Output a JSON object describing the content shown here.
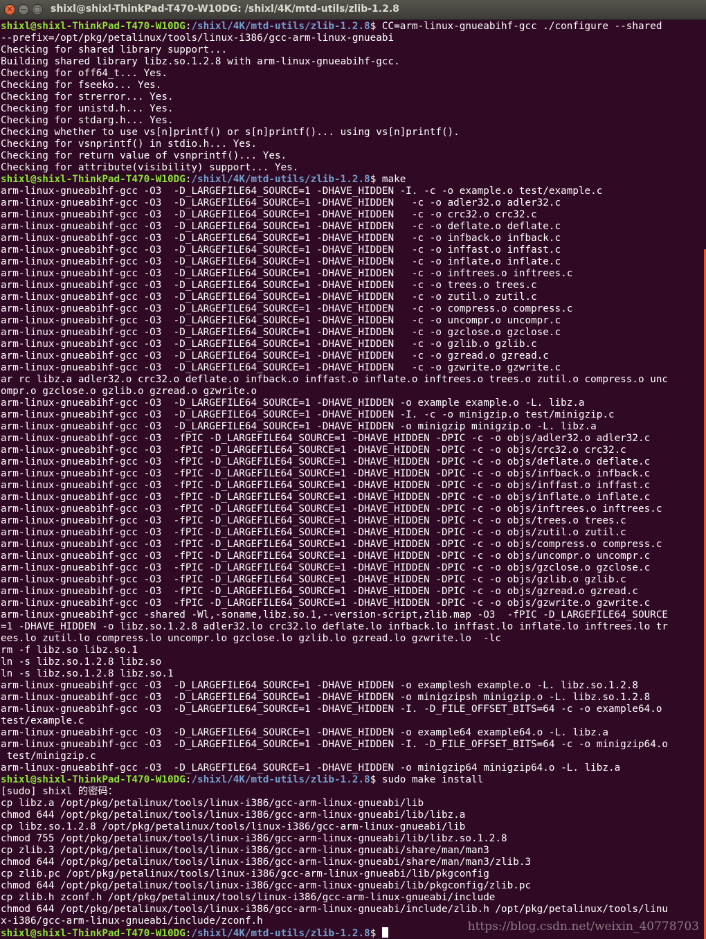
{
  "window": {
    "title": "shixl@shixl-ThinkPad-T470-W10DG: /shixl/4K/mtd-utils/zlib-1.2.8",
    "close_glyph": "✕",
    "minimize_glyph": "−",
    "maximize_glyph": "□"
  },
  "prompt": {
    "user_host": "shixl@shixl-ThinkPad-T470-W10DG",
    "separator": ":",
    "path": "/shixl/4K/mtd-utils/zlib-1.2.8",
    "symbol": "$ "
  },
  "lines": [
    {
      "type": "prompt",
      "cmd": "CC=arm-linux-gnueabihf-gcc ./configure --shared"
    },
    {
      "type": "out",
      "text": "--prefix=/opt/pkg/petalinux/tools/linux-i386/gcc-arm-linux-gnueabi"
    },
    {
      "type": "out",
      "text": "Checking for shared library support..."
    },
    {
      "type": "out",
      "text": "Building shared library libz.so.1.2.8 with arm-linux-gnueabihf-gcc."
    },
    {
      "type": "out",
      "text": "Checking for off64_t... Yes."
    },
    {
      "type": "out",
      "text": "Checking for fseeko... Yes."
    },
    {
      "type": "out",
      "text": "Checking for strerror... Yes."
    },
    {
      "type": "out",
      "text": "Checking for unistd.h... Yes."
    },
    {
      "type": "out",
      "text": "Checking for stdarg.h... Yes."
    },
    {
      "type": "out",
      "text": "Checking whether to use vs[n]printf() or s[n]printf()... using vs[n]printf()."
    },
    {
      "type": "out",
      "text": "Checking for vsnprintf() in stdio.h... Yes."
    },
    {
      "type": "out",
      "text": "Checking for return value of vsnprintf()... Yes."
    },
    {
      "type": "out",
      "text": "Checking for attribute(visibility) support... Yes."
    },
    {
      "type": "prompt",
      "cmd": "make"
    },
    {
      "type": "out",
      "text": "arm-linux-gnueabihf-gcc -O3  -D_LARGEFILE64_SOURCE=1 -DHAVE_HIDDEN -I. -c -o example.o test/example.c"
    },
    {
      "type": "out",
      "text": "arm-linux-gnueabihf-gcc -O3  -D_LARGEFILE64_SOURCE=1 -DHAVE_HIDDEN   -c -o adler32.o adler32.c"
    },
    {
      "type": "out",
      "text": "arm-linux-gnueabihf-gcc -O3  -D_LARGEFILE64_SOURCE=1 -DHAVE_HIDDEN   -c -o crc32.o crc32.c"
    },
    {
      "type": "out",
      "text": "arm-linux-gnueabihf-gcc -O3  -D_LARGEFILE64_SOURCE=1 -DHAVE_HIDDEN   -c -o deflate.o deflate.c"
    },
    {
      "type": "out",
      "text": "arm-linux-gnueabihf-gcc -O3  -D_LARGEFILE64_SOURCE=1 -DHAVE_HIDDEN   -c -o infback.o infback.c"
    },
    {
      "type": "out",
      "text": "arm-linux-gnueabihf-gcc -O3  -D_LARGEFILE64_SOURCE=1 -DHAVE_HIDDEN   -c -o inffast.o inffast.c"
    },
    {
      "type": "out",
      "text": "arm-linux-gnueabihf-gcc -O3  -D_LARGEFILE64_SOURCE=1 -DHAVE_HIDDEN   -c -o inflate.o inflate.c"
    },
    {
      "type": "out",
      "text": "arm-linux-gnueabihf-gcc -O3  -D_LARGEFILE64_SOURCE=1 -DHAVE_HIDDEN   -c -o inftrees.o inftrees.c"
    },
    {
      "type": "out",
      "text": "arm-linux-gnueabihf-gcc -O3  -D_LARGEFILE64_SOURCE=1 -DHAVE_HIDDEN   -c -o trees.o trees.c"
    },
    {
      "type": "out",
      "text": "arm-linux-gnueabihf-gcc -O3  -D_LARGEFILE64_SOURCE=1 -DHAVE_HIDDEN   -c -o zutil.o zutil.c"
    },
    {
      "type": "out",
      "text": "arm-linux-gnueabihf-gcc -O3  -D_LARGEFILE64_SOURCE=1 -DHAVE_HIDDEN   -c -o compress.o compress.c"
    },
    {
      "type": "out",
      "text": "arm-linux-gnueabihf-gcc -O3  -D_LARGEFILE64_SOURCE=1 -DHAVE_HIDDEN   -c -o uncompr.o uncompr.c"
    },
    {
      "type": "out",
      "text": "arm-linux-gnueabihf-gcc -O3  -D_LARGEFILE64_SOURCE=1 -DHAVE_HIDDEN   -c -o gzclose.o gzclose.c"
    },
    {
      "type": "out",
      "text": "arm-linux-gnueabihf-gcc -O3  -D_LARGEFILE64_SOURCE=1 -DHAVE_HIDDEN   -c -o gzlib.o gzlib.c"
    },
    {
      "type": "out",
      "text": "arm-linux-gnueabihf-gcc -O3  -D_LARGEFILE64_SOURCE=1 -DHAVE_HIDDEN   -c -o gzread.o gzread.c"
    },
    {
      "type": "out",
      "text": "arm-linux-gnueabihf-gcc -O3  -D_LARGEFILE64_SOURCE=1 -DHAVE_HIDDEN   -c -o gzwrite.o gzwrite.c"
    },
    {
      "type": "out",
      "text": "ar rc libz.a adler32.o crc32.o deflate.o infback.o inffast.o inflate.o inftrees.o trees.o zutil.o compress.o unc"
    },
    {
      "type": "out",
      "text": "ompr.o gzclose.o gzlib.o gzread.o gzwrite.o"
    },
    {
      "type": "out",
      "text": "arm-linux-gnueabihf-gcc -O3  -D_LARGEFILE64_SOURCE=1 -DHAVE_HIDDEN -o example example.o -L. libz.a"
    },
    {
      "type": "out",
      "text": "arm-linux-gnueabihf-gcc -O3  -D_LARGEFILE64_SOURCE=1 -DHAVE_HIDDEN -I. -c -o minigzip.o test/minigzip.c"
    },
    {
      "type": "out",
      "text": "arm-linux-gnueabihf-gcc -O3  -D_LARGEFILE64_SOURCE=1 -DHAVE_HIDDEN -o minigzip minigzip.o -L. libz.a"
    },
    {
      "type": "out",
      "text": "arm-linux-gnueabihf-gcc -O3  -fPIC -D_LARGEFILE64_SOURCE=1 -DHAVE_HIDDEN -DPIC -c -o objs/adler32.o adler32.c"
    },
    {
      "type": "out",
      "text": "arm-linux-gnueabihf-gcc -O3  -fPIC -D_LARGEFILE64_SOURCE=1 -DHAVE_HIDDEN -DPIC -c -o objs/crc32.o crc32.c"
    },
    {
      "type": "out",
      "text": "arm-linux-gnueabihf-gcc -O3  -fPIC -D_LARGEFILE64_SOURCE=1 -DHAVE_HIDDEN -DPIC -c -o objs/deflate.o deflate.c"
    },
    {
      "type": "out",
      "text": "arm-linux-gnueabihf-gcc -O3  -fPIC -D_LARGEFILE64_SOURCE=1 -DHAVE_HIDDEN -DPIC -c -o objs/infback.o infback.c"
    },
    {
      "type": "out",
      "text": "arm-linux-gnueabihf-gcc -O3  -fPIC -D_LARGEFILE64_SOURCE=1 -DHAVE_HIDDEN -DPIC -c -o objs/inffast.o inffast.c"
    },
    {
      "type": "out",
      "text": "arm-linux-gnueabihf-gcc -O3  -fPIC -D_LARGEFILE64_SOURCE=1 -DHAVE_HIDDEN -DPIC -c -o objs/inflate.o inflate.c"
    },
    {
      "type": "out",
      "text": "arm-linux-gnueabihf-gcc -O3  -fPIC -D_LARGEFILE64_SOURCE=1 -DHAVE_HIDDEN -DPIC -c -o objs/inftrees.o inftrees.c"
    },
    {
      "type": "out",
      "text": "arm-linux-gnueabihf-gcc -O3  -fPIC -D_LARGEFILE64_SOURCE=1 -DHAVE_HIDDEN -DPIC -c -o objs/trees.o trees.c"
    },
    {
      "type": "out",
      "text": "arm-linux-gnueabihf-gcc -O3  -fPIC -D_LARGEFILE64_SOURCE=1 -DHAVE_HIDDEN -DPIC -c -o objs/zutil.o zutil.c"
    },
    {
      "type": "out",
      "text": "arm-linux-gnueabihf-gcc -O3  -fPIC -D_LARGEFILE64_SOURCE=1 -DHAVE_HIDDEN -DPIC -c -o objs/compress.o compress.c"
    },
    {
      "type": "out",
      "text": "arm-linux-gnueabihf-gcc -O3  -fPIC -D_LARGEFILE64_SOURCE=1 -DHAVE_HIDDEN -DPIC -c -o objs/uncompr.o uncompr.c"
    },
    {
      "type": "out",
      "text": "arm-linux-gnueabihf-gcc -O3  -fPIC -D_LARGEFILE64_SOURCE=1 -DHAVE_HIDDEN -DPIC -c -o objs/gzclose.o gzclose.c"
    },
    {
      "type": "out",
      "text": "arm-linux-gnueabihf-gcc -O3  -fPIC -D_LARGEFILE64_SOURCE=1 -DHAVE_HIDDEN -DPIC -c -o objs/gzlib.o gzlib.c"
    },
    {
      "type": "out",
      "text": "arm-linux-gnueabihf-gcc -O3  -fPIC -D_LARGEFILE64_SOURCE=1 -DHAVE_HIDDEN -DPIC -c -o objs/gzread.o gzread.c"
    },
    {
      "type": "out",
      "text": "arm-linux-gnueabihf-gcc -O3  -fPIC -D_LARGEFILE64_SOURCE=1 -DHAVE_HIDDEN -DPIC -c -o objs/gzwrite.o gzwrite.c"
    },
    {
      "type": "out",
      "text": "arm-linux-gnueabihf-gcc -shared -Wl,-soname,libz.so.1,--version-script,zlib.map -O3  -fPIC -D_LARGEFILE64_SOURCE"
    },
    {
      "type": "out",
      "text": "=1 -DHAVE_HIDDEN -o libz.so.1.2.8 adler32.lo crc32.lo deflate.lo infback.lo inffast.lo inflate.lo inftrees.lo tr"
    },
    {
      "type": "out",
      "text": "ees.lo zutil.lo compress.lo uncompr.lo gzclose.lo gzlib.lo gzread.lo gzwrite.lo  -lc"
    },
    {
      "type": "out",
      "text": "rm -f libz.so libz.so.1"
    },
    {
      "type": "out",
      "text": "ln -s libz.so.1.2.8 libz.so"
    },
    {
      "type": "out",
      "text": "ln -s libz.so.1.2.8 libz.so.1"
    },
    {
      "type": "out",
      "text": "arm-linux-gnueabihf-gcc -O3  -D_LARGEFILE64_SOURCE=1 -DHAVE_HIDDEN -o examplesh example.o -L. libz.so.1.2.8"
    },
    {
      "type": "out",
      "text": "arm-linux-gnueabihf-gcc -O3  -D_LARGEFILE64_SOURCE=1 -DHAVE_HIDDEN -o minigzipsh minigzip.o -L. libz.so.1.2.8"
    },
    {
      "type": "out",
      "text": "arm-linux-gnueabihf-gcc -O3  -D_LARGEFILE64_SOURCE=1 -DHAVE_HIDDEN -I. -D_FILE_OFFSET_BITS=64 -c -o example64.o"
    },
    {
      "type": "out",
      "text": "test/example.c"
    },
    {
      "type": "out",
      "text": "arm-linux-gnueabihf-gcc -O3  -D_LARGEFILE64_SOURCE=1 -DHAVE_HIDDEN -o example64 example64.o -L. libz.a"
    },
    {
      "type": "out",
      "text": "arm-linux-gnueabihf-gcc -O3  -D_LARGEFILE64_SOURCE=1 -DHAVE_HIDDEN -I. -D_FILE_OFFSET_BITS=64 -c -o minigzip64.o"
    },
    {
      "type": "out",
      "text": " test/minigzip.c"
    },
    {
      "type": "out",
      "text": "arm-linux-gnueabihf-gcc -O3  -D_LARGEFILE64_SOURCE=1 -DHAVE_HIDDEN -o minigzip64 minigzip64.o -L. libz.a"
    },
    {
      "type": "prompt",
      "cmd": "sudo make install"
    },
    {
      "type": "out",
      "text": "[sudo] shixl 的密码："
    },
    {
      "type": "out",
      "text": "cp libz.a /opt/pkg/petalinux/tools/linux-i386/gcc-arm-linux-gnueabi/lib"
    },
    {
      "type": "out",
      "text": "chmod 644 /opt/pkg/petalinux/tools/linux-i386/gcc-arm-linux-gnueabi/lib/libz.a"
    },
    {
      "type": "out",
      "text": "cp libz.so.1.2.8 /opt/pkg/petalinux/tools/linux-i386/gcc-arm-linux-gnueabi/lib"
    },
    {
      "type": "out",
      "text": "chmod 755 /opt/pkg/petalinux/tools/linux-i386/gcc-arm-linux-gnueabi/lib/libz.so.1.2.8"
    },
    {
      "type": "out",
      "text": "cp zlib.3 /opt/pkg/petalinux/tools/linux-i386/gcc-arm-linux-gnueabi/share/man/man3"
    },
    {
      "type": "out",
      "text": "chmod 644 /opt/pkg/petalinux/tools/linux-i386/gcc-arm-linux-gnueabi/share/man/man3/zlib.3"
    },
    {
      "type": "out",
      "text": "cp zlib.pc /opt/pkg/petalinux/tools/linux-i386/gcc-arm-linux-gnueabi/lib/pkgconfig"
    },
    {
      "type": "out",
      "text": "chmod 644 /opt/pkg/petalinux/tools/linux-i386/gcc-arm-linux-gnueabi/lib/pkgconfig/zlib.pc"
    },
    {
      "type": "out",
      "text": "cp zlib.h zconf.h /opt/pkg/petalinux/tools/linux-i386/gcc-arm-linux-gnueabi/include"
    },
    {
      "type": "out",
      "text": "chmod 644 /opt/pkg/petalinux/tools/linux-i386/gcc-arm-linux-gnueabi/include/zlib.h /opt/pkg/petalinux/tools/linu"
    },
    {
      "type": "out",
      "text": "x-i386/gcc-arm-linux-gnueabi/include/zconf.h"
    },
    {
      "type": "prompt",
      "cmd": "",
      "cursor": true
    }
  ],
  "watermark": "https://blog.csdn.net/weixin_40778703",
  "colors": {
    "background": "#300a24",
    "prompt_user": "#8ae234",
    "prompt_path": "#729fcf",
    "text": "#ffffff",
    "scrollbar": "#e8562f"
  }
}
